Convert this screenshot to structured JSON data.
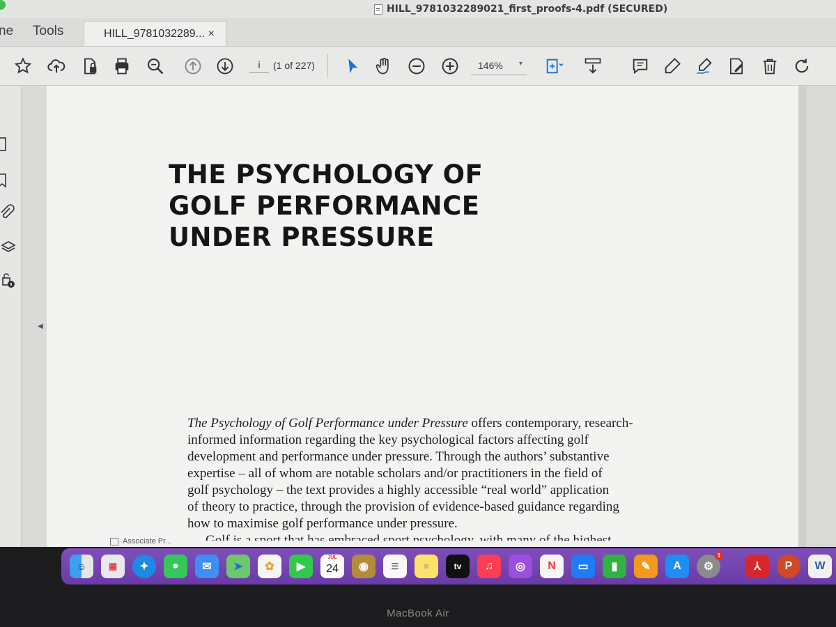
{
  "window": {
    "title": "HILL_9781032289021_first_proofs-4.pdf (SECURED)"
  },
  "tabbar": {
    "home_partial": "ne",
    "tools": "Tools",
    "active_tab": "HILL_9781032289...",
    "close_glyph": "×"
  },
  "toolbar": {
    "icons": [
      "star-icon",
      "cloud-upload-icon",
      "lock-file-icon",
      "printer-icon",
      "zoom-search-icon",
      "page-up-icon",
      "page-down-icon",
      "select-arrow-icon",
      "hand-icon",
      "zoom-out-icon",
      "zoom-in-icon",
      "fit-page-icon",
      "scroll-mode-icon",
      "comment-icon",
      "highlight-icon",
      "sign-icon",
      "edit-icon",
      "delete-icon",
      "rotate-icon"
    ],
    "page_current": "i",
    "page_count": "(1 of 227)",
    "zoom": "146%",
    "zoom_caret": "▾"
  },
  "document": {
    "title_lines": [
      "THE PSYCHOLOGY OF",
      "GOLF PERFORMANCE",
      "UNDER PRESSURE"
    ],
    "blurb_title_italic": "The Psychology of Golf Performance under Pressure",
    "blurb_line1_rest": " offers contemporary, research-",
    "blurb_lines": [
      "informed information regarding the key psychological factors affecting golf",
      "development and performance under pressure. Through the authors’ substantive",
      "expertise – all of whom are notable scholars and/or practitioners in the field of",
      "golf psychology – the text provides a highly accessible “real world” application",
      "of theory to practice, through the provision of evidence-based guidance regarding",
      "how to maximise golf performance under pressure."
    ],
    "blurb_cut_line": "Golf is a sport that has embraced sport psychology, with many of the highest",
    "footer_partial": "Associate Pr..."
  },
  "dock": {
    "calendar_month": "JUL",
    "calendar_day": "24",
    "tv_label": "tv",
    "settings_badge": "1",
    "apps": [
      "finder",
      "launchpad",
      "safari",
      "messages",
      "mail",
      "maps",
      "photos",
      "facetime",
      "calendar",
      "notes-folder",
      "reminders",
      "notes",
      "apple-tv",
      "music",
      "podcasts",
      "news",
      "keynote",
      "numbers",
      "pages",
      "app-store",
      "system-preferences",
      "acrobat",
      "powerpoint",
      "word"
    ]
  },
  "device_label": "MacBook Air"
}
